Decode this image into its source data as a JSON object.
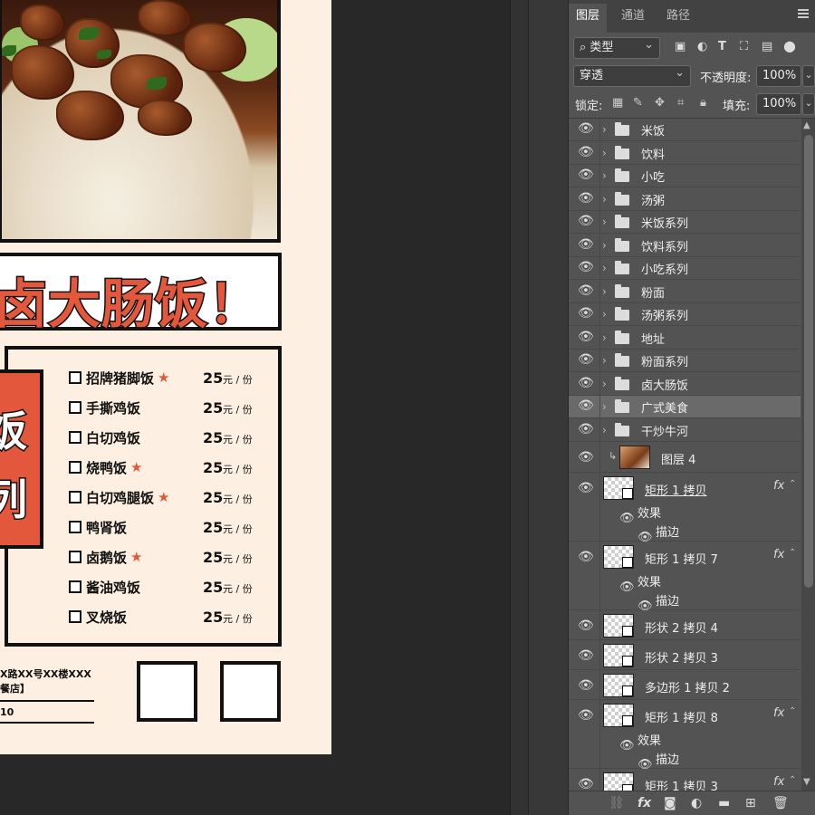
{
  "document": {
    "title_text": "卤大肠饭！",
    "tag_chars": [
      "饭",
      "列"
    ],
    "menu": [
      {
        "dish": "招牌猪脚饭",
        "star": true,
        "price": "25",
        "unit": "元 / 份"
      },
      {
        "dish": "手撕鸡饭",
        "star": false,
        "price": "25",
        "unit": "元 / 份"
      },
      {
        "dish": "白切鸡饭",
        "star": false,
        "price": "25",
        "unit": "元 / 份"
      },
      {
        "dish": "烧鸭饭",
        "star": true,
        "price": "25",
        "unit": "元 / 份"
      },
      {
        "dish": "白切鸡腿饭",
        "star": true,
        "price": "25",
        "unit": "元 / 份"
      },
      {
        "dish": "鸭肾饭",
        "star": false,
        "price": "25",
        "unit": "元 / 份"
      },
      {
        "dish": "卤鹅饭",
        "star": true,
        "price": "25",
        "unit": "元 / 份"
      },
      {
        "dish": "酱油鸡饭",
        "star": false,
        "price": "25",
        "unit": "元 / 份"
      },
      {
        "dish": "叉烧饭",
        "star": false,
        "price": "25",
        "unit": "元 / 份"
      }
    ],
    "address_line1": "X路XX号XX楼XXX",
    "address_line2": "餐店】",
    "address_line3": "10",
    "accent_color": "#e3583c"
  },
  "panel": {
    "tabs": [
      "图层",
      "通道",
      "路径"
    ],
    "filter_kind": "类型",
    "blend_mode": "穿透",
    "opacity_label": "不透明度:",
    "opacity_value": "100%",
    "lock_label": "锁定:",
    "fill_label": "填充:",
    "fill_value": "100%",
    "groups": [
      "米饭",
      "饮料",
      "小吃",
      "汤粥",
      "米饭系列",
      "饮料系列",
      "小吃系列",
      "粉面",
      "汤粥系列",
      "地址",
      "粉面系列",
      "卤大肠饭",
      "广式美食",
      "干炒牛河"
    ],
    "selected_group": "广式美食",
    "layer_image": "图层 4",
    "layers": [
      {
        "name": "矩形 1 拷贝",
        "fx": "fx",
        "effects_label": "效果",
        "effect": "描边"
      },
      {
        "name": "矩形 1 拷贝 7",
        "fx": "fx",
        "effects_label": "效果",
        "effect": "描边"
      },
      {
        "name": "形状 2 拷贝 4"
      },
      {
        "name": "形状 2 拷贝 3"
      },
      {
        "name": "多边形 1 拷贝 2"
      },
      {
        "name": "矩形 1 拷贝 8",
        "fx": "fx",
        "effects_label": "效果",
        "effect": "描边"
      },
      {
        "name": "矩形 1 拷贝 3",
        "fx": "fx"
      }
    ]
  }
}
